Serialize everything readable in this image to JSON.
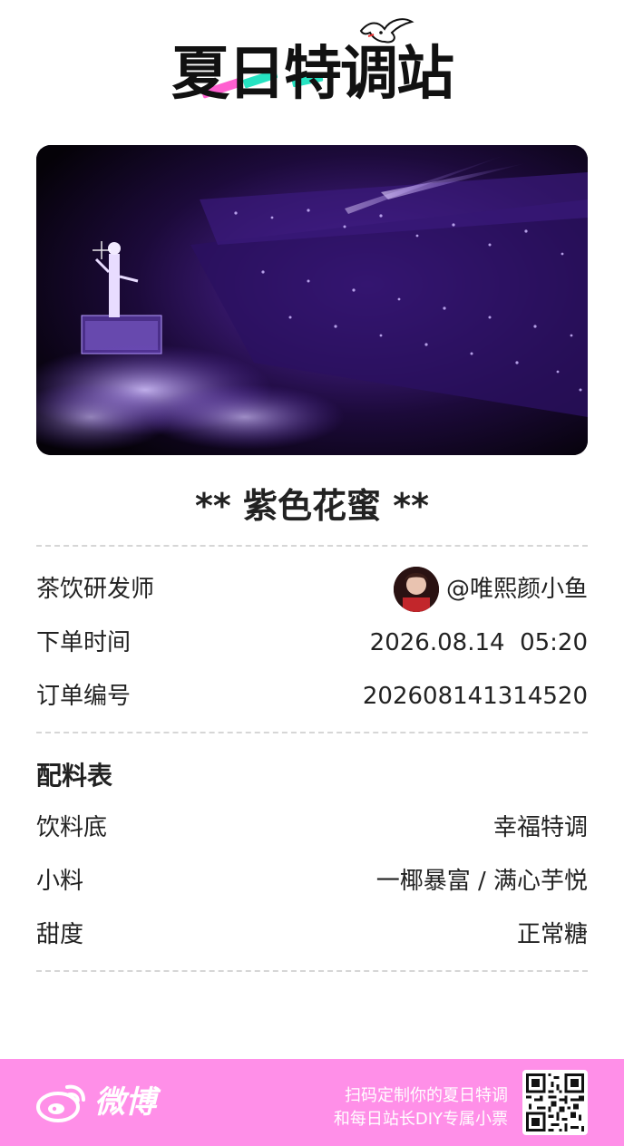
{
  "logo": {
    "text": "夏日特调站"
  },
  "drink": {
    "title": "** 紫色花蜜 **"
  },
  "order": {
    "rows": [
      {
        "label": "茶饮研发师",
        "value": "@唯熙颜小鱼"
      },
      {
        "label": "下单时间",
        "value": "2026.08.14  05:20"
      },
      {
        "label": "订单编号",
        "value": "202608141314520"
      }
    ]
  },
  "ingredients": {
    "title": "配料表",
    "rows": [
      {
        "label": "饮料底",
        "value": "幸福特调"
      },
      {
        "label": "小料",
        "value": "一椰暴富 / 满心芋悦"
      },
      {
        "label": "甜度",
        "value": "正常糖"
      }
    ]
  },
  "footer": {
    "brand": "微博",
    "line1": "扫码定制你的夏日特调",
    "line2": "和每日站长DIY专属小票"
  },
  "colors": {
    "footer_bg": "#ff8fe8",
    "accent_pink": "#ff5fd0",
    "accent_teal": "#26e3c2"
  }
}
